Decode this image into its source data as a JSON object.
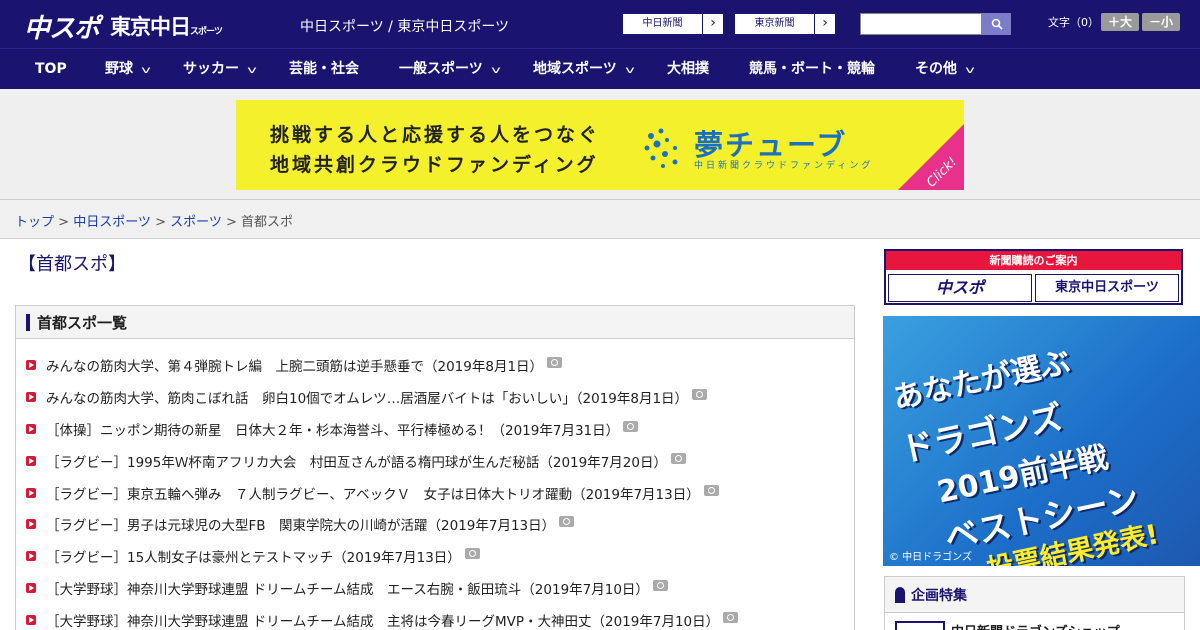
{
  "header": {
    "logo_main": "中スポ",
    "logo_tokyo": "東京中日",
    "logo_tokyo_small": "スポーツ",
    "site_links": "中日スポーツ / 東京中日スポーツ",
    "chunichi_link": "中日新聞",
    "tokyo_link": "東京新聞",
    "search_placeholder": "",
    "font_label": "文字（0）",
    "font_larger": "＋大",
    "font_smaller": "－小"
  },
  "nav": {
    "items": [
      {
        "label": "TOP",
        "dropdown": false
      },
      {
        "label": "野球",
        "dropdown": true
      },
      {
        "label": "サッカー",
        "dropdown": true
      },
      {
        "label": "芸能・社会",
        "dropdown": false
      },
      {
        "label": "一般スポーツ",
        "dropdown": true
      },
      {
        "label": "地域スポーツ",
        "dropdown": true
      },
      {
        "label": "大相撲",
        "dropdown": false
      },
      {
        "label": "競馬・ボート・競輪",
        "dropdown": false
      },
      {
        "label": "その他",
        "dropdown": true
      }
    ]
  },
  "banner": {
    "line1": "挑戦する人と応援する人をつなぐ",
    "line2": "地域共創クラウドファンディング",
    "brand": "夢チューブ",
    "brand_sub": "中日新聞クラウドファンディング",
    "click": "Click!"
  },
  "breadcrumb": {
    "top": "トップ",
    "chunichi_sports": "中日スポーツ",
    "sports": "スポーツ",
    "current": "首都スポ",
    "sep": " > "
  },
  "main": {
    "page_title": "【首都スポ】",
    "list_title": "首都スポ一覧",
    "items": [
      "みんなの筋肉大学、第４弾腕トレ編　上腕二頭筋は逆手懸垂で（2019年8月1日）",
      "みんなの筋肉大学、筋肉こぼれ話　卵白10個でオムレツ…居酒屋バイトは「おいしい」（2019年8月1日）",
      "［体操］ニッポン期待の新星　日体大２年・杉本海誉斗、平行棒極める！（2019年7月31日）",
      "［ラグビー］1995年Ｗ杯南アフリカ大会　村田亙さんが語る楕円球が生んだ秘話（2019年7月20日）",
      "［ラグビー］東京五輪へ弾み　７人制ラグビー、アベックＶ　女子は日体大トリオ躍動（2019年7月13日）",
      "［ラグビー］男子は元球児の大型FB　関東学院大の川崎が活躍（2019年7月13日）",
      "［ラグビー］15人制女子は豪州とテストマッチ（2019年7月13日）",
      "［大学野球］神奈川大学野球連盟 ドリームチーム結成　エース右腕・飯田琉斗（2019年7月10日）",
      "［大学野球］神奈川大学野球連盟 ドリームチーム結成　主将は今春リーグMVP・大神田丈（2019年7月10日）"
    ]
  },
  "sidebar": {
    "subscription_head": "新聞購読のご案内",
    "sub_logo1": "中スポ",
    "sub_logo2": "東京中日スポーツ",
    "ad_line1": "あなたが選ぶ",
    "ad_line2": "ドラゴンズ",
    "ad_line3": "2019前半戦",
    "ad_line4": "ベストシーン",
    "ad_result": "投票結果発表!",
    "ad_copyright": "© 中日ドラゴンズ",
    "feature_title": "企画特集",
    "feature_item": "中日新聞ドラゴンズショップ"
  },
  "colors": {
    "header_bg": "#1a1470",
    "bullet": "#d21a3a",
    "banner_bg": "#f4f12c",
    "banner_accent": "#1c70c0",
    "subscription_red": "#e8163c"
  }
}
